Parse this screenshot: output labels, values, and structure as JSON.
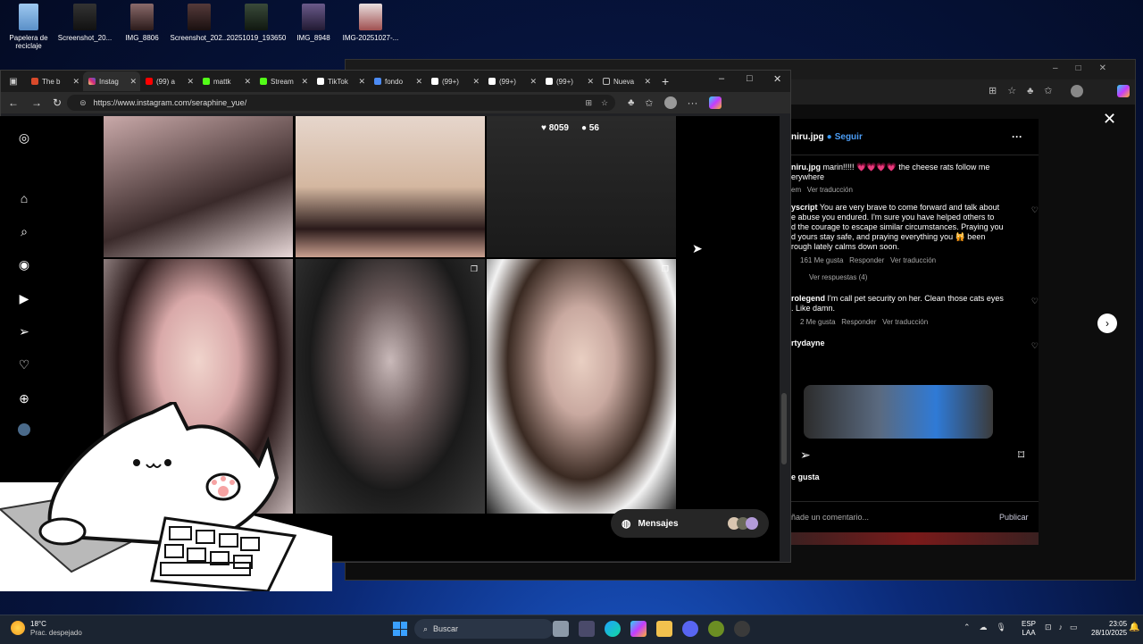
{
  "desktop": {
    "icons": [
      {
        "label": "Papelera de reciclaje"
      },
      {
        "label": "Screenshot_20..."
      },
      {
        "label": "IMG_8806"
      },
      {
        "label": "Screenshot_202..."
      },
      {
        "label": "20251019_193650"
      },
      {
        "label": "IMG_8948"
      },
      {
        "label": "IMG-20251027-..."
      }
    ]
  },
  "browser": {
    "tabs": [
      {
        "label": "The b",
        "color": "#d94a2b"
      },
      {
        "label": "Instag",
        "color": "#d62976"
      },
      {
        "label": "(99) a",
        "color": "#ff0000"
      },
      {
        "label": "mattk",
        "color": "#53fc18"
      },
      {
        "label": "Stream",
        "color": "#53fc18"
      },
      {
        "label": "TikTok",
        "color": "#ffffff"
      },
      {
        "label": "fondo",
        "color": "#4c8bf5"
      },
      {
        "label": "(99+)",
        "color": "#ffffff"
      },
      {
        "label": "(99+)",
        "color": "#ffffff"
      },
      {
        "label": "(99+)",
        "color": "#ffffff"
      },
      {
        "label": "Nueva",
        "color": "#bbbbbb"
      }
    ],
    "url": "https://www.instagram.com/seraphine_yue/"
  },
  "post_stats": {
    "likes": "8059",
    "comments": "56"
  },
  "messages_label": "Mensajes",
  "post_modal": {
    "author": "niru.jpg",
    "follow": "Seguir",
    "caption_author": "niru.jpg",
    "caption": "marin!!!!! 💗💗💗💗 the cheese rats follow me",
    "caption_cont": "erywhere",
    "caption_meta_time": "em",
    "caption_meta_translate": "Ver traducción",
    "comments": [
      {
        "author": "yscript",
        "text": "You are very brave to come forward and talk about",
        "lines": [
          "e abuse you endured. I'm sure you have helped others to",
          "d the courage to escape similar circumstances. Praying you",
          "d yours stay safe, and praying everything you 🙀 been",
          "rough lately calms down soon."
        ],
        "likes": "161 Me gusta",
        "reply": "Responder",
        "translate": "Ver traducción",
        "replies": "Ver respuestas (4)"
      },
      {
        "author": "rolegend",
        "text": "I'm call pet security on her. Clean those cats eyes",
        "lines": [
          ". Like damn."
        ],
        "likes": "2 Me gusta",
        "reply": "Responder",
        "translate": "Ver traducción"
      },
      {
        "author": "rtydayne",
        "text": "",
        "lines": []
      }
    ],
    "likes_label": "e gusta",
    "add_comment": "ñade un comentario...",
    "publish": "Publicar"
  },
  "taskbar": {
    "weather_temp": "18°C",
    "weather_desc": "Prac. despejado",
    "search": "Buscar",
    "lang1": "ESP",
    "lang2": "LAA",
    "time": "23:05",
    "date": "28/10/2025"
  }
}
